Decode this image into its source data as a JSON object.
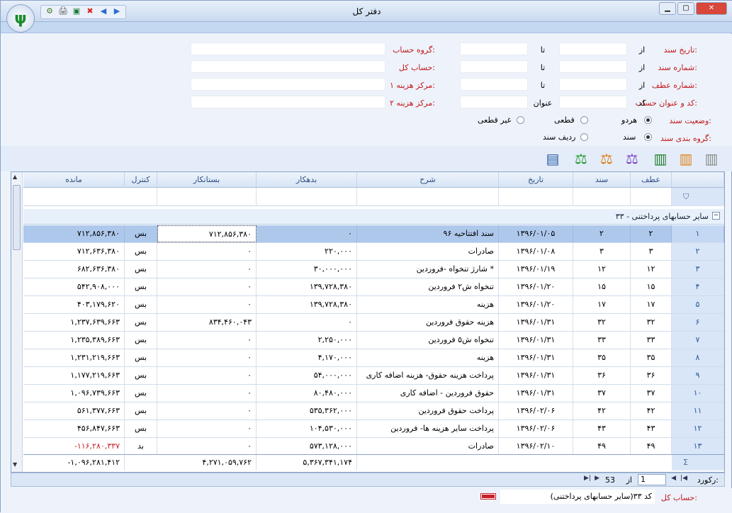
{
  "window": {
    "title": "دفتر کل"
  },
  "filters": {
    "date_label": "تاریخ سند:",
    "doc_no_label": "شماره سند:",
    "atf_no_label": "شماره عطف:",
    "code_title_label": "کد و عنوان حساب:",
    "status_label": "وضعیت سند:",
    "grouping_label": "گروه بندی سند:",
    "account_group_label": "گروه حساب:",
    "ledger_label": "حساب کل:",
    "cost_center1_label": "مرکز هزینه ۱:",
    "cost_center2_label": "مرکز هزینه ۲:",
    "from": "از",
    "to": "تا",
    "code": "کد",
    "title": "عنوان",
    "status_opts": [
      "هردو",
      "قطعی",
      "غیر قطعی"
    ],
    "status_selected": "هردو",
    "group_opts": [
      "سند",
      "ردیف سند"
    ],
    "group_selected": "سند"
  },
  "grid": {
    "columns": [
      "عطف",
      "سند",
      "تاریخ",
      "شرح",
      "بدهکار",
      "بستانکار",
      "کنترل",
      "مانده"
    ],
    "group_title": "۳۳ - سایر حسابهای پرداختنی",
    "rows": [
      {
        "n": "۱",
        "atf": "۲",
        "doc": "۲",
        "date": "۱۳۹۶/۰۱/۰۵",
        "desc": "سند افتتاحیه ۹۶",
        "debit": "۰",
        "credit": "۷۱۲,۸۵۶,۳۸۰",
        "ctrl": "بس",
        "bal": "۷۱۲,۸۵۶,۳۸۰"
      },
      {
        "n": "۲",
        "atf": "۳",
        "doc": "۳",
        "date": "۱۳۹۶/۰۱/۰۸",
        "desc": "صادرات",
        "debit": "۲۲۰,۰۰۰",
        "credit": "۰",
        "ctrl": "بس",
        "bal": "۷۱۲,۶۳۶,۳۸۰"
      },
      {
        "n": "۳",
        "atf": "۱۲",
        "doc": "۱۲",
        "date": "۱۳۹۶/۰۱/۱۹",
        "desc": "شارژ تنخواه -فروردین *",
        "debit": "۳۰,۰۰۰,۰۰۰",
        "credit": "۰",
        "ctrl": "بس",
        "bal": "۶۸۲,۶۳۶,۳۸۰"
      },
      {
        "n": "۴",
        "atf": "۱۵",
        "doc": "۱۵",
        "date": "۱۳۹۶/۰۱/۲۰",
        "desc": "تنخواه ش۲ فروردین",
        "debit": "۱۳۹,۷۲۸,۳۸۰",
        "credit": "۰",
        "ctrl": "بس",
        "bal": "۵۴۲,۹۰۸,۰۰۰"
      },
      {
        "n": "۵",
        "atf": "۱۷",
        "doc": "۱۷",
        "date": "۱۳۹۶/۰۱/۲۰",
        "desc": "هزینه",
        "debit": "۱۳۹,۷۲۸,۳۸۰",
        "credit": "۰",
        "ctrl": "بس",
        "bal": "۴۰۳,۱۷۹,۶۲۰"
      },
      {
        "n": "۶",
        "atf": "۳۲",
        "doc": "۳۲",
        "date": "۱۳۹۶/۰۱/۳۱",
        "desc": "هزینه حقوق فروردین",
        "debit": "۰",
        "credit": "۸۳۴,۴۶۰,۰۴۳",
        "ctrl": "بس",
        "bal": "۱,۲۳۷,۶۳۹,۶۶۳"
      },
      {
        "n": "۷",
        "atf": "۳۳",
        "doc": "۳۳",
        "date": "۱۳۹۶/۰۱/۳۱",
        "desc": "تنخواه ش۵ فروردین",
        "debit": "۲,۲۵۰,۰۰۰",
        "credit": "۰",
        "ctrl": "بس",
        "bal": "۱,۲۳۵,۳۸۹,۶۶۳"
      },
      {
        "n": "۸",
        "atf": "۳۵",
        "doc": "۳۵",
        "date": "۱۳۹۶/۰۱/۳۱",
        "desc": "هزینه",
        "debit": "۴,۱۷۰,۰۰۰",
        "credit": "۰",
        "ctrl": "بس",
        "bal": "۱,۲۳۱,۲۱۹,۶۶۳"
      },
      {
        "n": "۹",
        "atf": "۳۶",
        "doc": "۳۶",
        "date": "۱۳۹۶/۰۱/۳۱",
        "desc": "پرداخت هزینه حقوق- هزینه اضافه کاری",
        "debit": "۵۴,۰۰۰,۰۰۰",
        "credit": "۰",
        "ctrl": "بس",
        "bal": "۱,۱۷۷,۲۱۹,۶۶۳"
      },
      {
        "n": "۱۰",
        "atf": "۳۷",
        "doc": "۳۷",
        "date": "۱۳۹۶/۰۱/۳۱",
        "desc": "حقوق فروردین - اضافه کاری",
        "debit": "۸۰,۴۸۰,۰۰۰",
        "credit": "۰",
        "ctrl": "بس",
        "bal": "۱,۰۹۶,۷۳۹,۶۶۳"
      },
      {
        "n": "۱۱",
        "atf": "۴۲",
        "doc": "۴۲",
        "date": "۱۳۹۶/۰۲/۰۶",
        "desc": "پرداخت حقوق فروردین",
        "debit": "۵۳۵,۳۶۲,۰۰۰",
        "credit": "۰",
        "ctrl": "بس",
        "bal": "۵۶۱,۳۷۷,۶۶۳"
      },
      {
        "n": "۱۲",
        "atf": "۴۳",
        "doc": "۴۳",
        "date": "۱۳۹۶/۰۲/۰۶",
        "desc": "پرداخت سایر هزینه ها- فروردین",
        "debit": "۱۰۴,۵۳۰,۰۰۰",
        "credit": "۰",
        "ctrl": "بس",
        "bal": "۴۵۶,۸۴۷,۶۶۳"
      },
      {
        "n": "۱۳",
        "atf": "۴۹",
        "doc": "۴۹",
        "date": "۱۳۹۶/۰۲/۱۰",
        "desc": "صادرات",
        "debit": "۵۷۳,۱۲۸,۰۰۰",
        "credit": "۰",
        "ctrl": "بد",
        "bal": "-۱۱۶,۲۸۰,۳۳۷",
        "neg": true
      }
    ],
    "totals": {
      "debit": "۵,۳۶۷,۳۴۱,۱۷۴",
      "credit": "۴,۲۷۱,۰۵۹,۷۶۲",
      "bal": "-۱,۰۹۶,۲۸۱,۴۱۲"
    }
  },
  "nav": {
    "label": "رکورد:",
    "current": "1",
    "of": "از",
    "total": "53"
  },
  "status": {
    "label": "حساب کل:",
    "value": "کد ۳۳(سایر حسابهای پرداختنی)"
  },
  "colors": {
    "label_red": "#c0181b",
    "selected_row": "#aec8ec",
    "negative": "#c8202a"
  }
}
